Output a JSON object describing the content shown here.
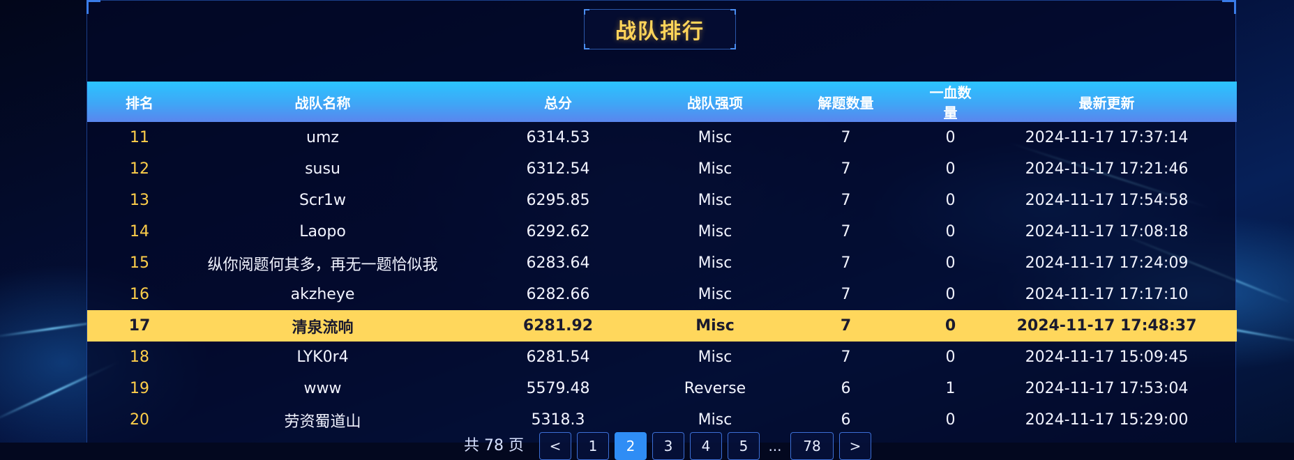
{
  "title": "战队排行",
  "columns": [
    "排名",
    "战队名称",
    "总分",
    "战队强项",
    "解题数量",
    "一血数量",
    "最新更新"
  ],
  "rows": [
    {
      "rank": "11",
      "name": "umz",
      "score": "6314.53",
      "strength": "Misc",
      "solved": "7",
      "first_blood": "0",
      "updated": "2024-11-17 17:37:14"
    },
    {
      "rank": "12",
      "name": "susu",
      "score": "6312.54",
      "strength": "Misc",
      "solved": "7",
      "first_blood": "0",
      "updated": "2024-11-17 17:21:46"
    },
    {
      "rank": "13",
      "name": "Scr1w",
      "score": "6295.85",
      "strength": "Misc",
      "solved": "7",
      "first_blood": "0",
      "updated": "2024-11-17 17:54:58"
    },
    {
      "rank": "14",
      "name": "Laopo",
      "score": "6292.62",
      "strength": "Misc",
      "solved": "7",
      "first_blood": "0",
      "updated": "2024-11-17 17:08:18"
    },
    {
      "rank": "15",
      "name": "纵你阅题何其多，再无一题恰似我",
      "score": "6283.64",
      "strength": "Misc",
      "solved": "7",
      "first_blood": "0",
      "updated": "2024-11-17 17:24:09"
    },
    {
      "rank": "16",
      "name": "akzheye",
      "score": "6282.66",
      "strength": "Misc",
      "solved": "7",
      "first_blood": "0",
      "updated": "2024-11-17 17:17:10"
    },
    {
      "rank": "17",
      "name": "清泉流响",
      "score": "6281.92",
      "strength": "Misc",
      "solved": "7",
      "first_blood": "0",
      "updated": "2024-11-17 17:48:37"
    },
    {
      "rank": "18",
      "name": "LYK0r4",
      "score": "6281.54",
      "strength": "Misc",
      "solved": "7",
      "first_blood": "0",
      "updated": "2024-11-17 15:09:45"
    },
    {
      "rank": "19",
      "name": "www",
      "score": "5579.48",
      "strength": "Reverse",
      "solved": "6",
      "first_blood": "1",
      "updated": "2024-11-17 17:53:04"
    },
    {
      "rank": "20",
      "name": "劳资蜀道山",
      "score": "5318.3",
      "strength": "Misc",
      "solved": "6",
      "first_blood": "0",
      "updated": "2024-11-17 15:29:00"
    }
  ],
  "highlighted_rank": "17",
  "pagination": {
    "total_text": "共 78 页",
    "prev": "<",
    "pages": [
      "1",
      "2",
      "3",
      "4",
      "5"
    ],
    "active_page": "2",
    "ellipsis": "...",
    "last": "78",
    "next": ">"
  },
  "colors": {
    "accent_gold": "#ffd75c",
    "header_blue": "#2bc4ff",
    "active_page": "#2f8df5",
    "background": "#03081f"
  }
}
